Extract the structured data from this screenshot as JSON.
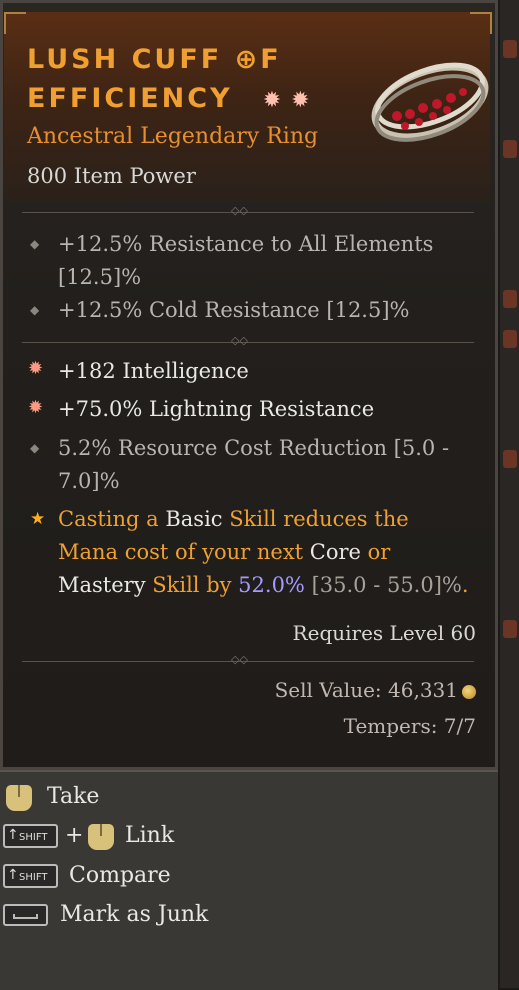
{
  "item": {
    "title_line1": "LUSH CUFF ⊕F",
    "title_line2": "EFFICIENCY",
    "socket_icon": "burst-socket-icon",
    "subtitle": "Ancestral Legendary Ring",
    "item_power": "800 Item Power"
  },
  "implicits": [
    {
      "line1": "+12.5% Resistance to All Elements",
      "line2": "[12.5]%"
    },
    {
      "line1": "+12.5% Cold Resistance [12.5]%"
    }
  ],
  "affixes": [
    {
      "text": "+182 Intelligence",
      "icon": "burst-icon"
    },
    {
      "text": "+75.0% Lightning Resistance",
      "icon": "burst-icon"
    },
    {
      "line1": "5.2% Resource Cost Reduction [5.0 -",
      "line2": "7.0]%",
      "icon": "diamond-bullet-icon"
    }
  ],
  "legendary": {
    "p1": "Casting a ",
    "p2": "Basic",
    "p3": " Skill reduces the",
    "p4": "Mana cost of your next ",
    "p5": "Core",
    "p6": " or",
    "p7": "Mastery",
    "p8": " Skill by ",
    "p9": "52.0%",
    "p10": " [35.0 - 55.0]%",
    "p11": "."
  },
  "footer": {
    "requires": "Requires Level 60",
    "sell_label": "Sell Value: 46,331",
    "tempers": "Tempers: 7/7"
  },
  "actions": {
    "take": "Take",
    "plus": "+",
    "link": "Link",
    "compare": "Compare",
    "junk": "Mark as Junk",
    "shift_key": "SHIFT"
  },
  "colors": {
    "legendary_orange": "#f0a030",
    "roll_purple": "#a898ff",
    "text_white": "#e8e8e4"
  }
}
